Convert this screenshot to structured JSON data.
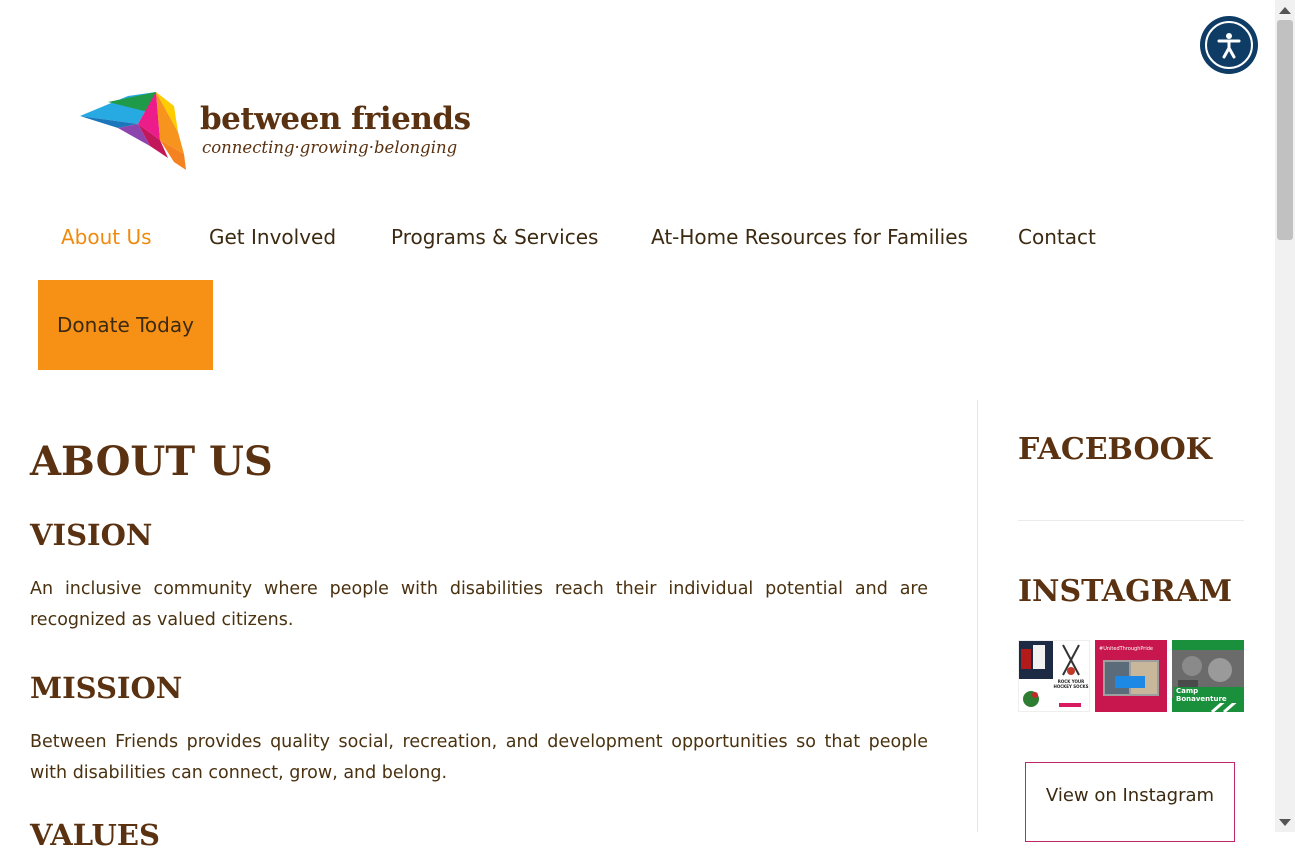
{
  "header": {
    "brand_name": "between friends",
    "tagline": "connecting·growing·belonging"
  },
  "nav": {
    "items": [
      {
        "label": "About Us",
        "active": true
      },
      {
        "label": "Get Involved"
      },
      {
        "label": "Programs & Services"
      },
      {
        "label": "At-Home Resources for Families"
      },
      {
        "label": "Contact"
      }
    ],
    "donate_label": "Donate Today"
  },
  "main": {
    "page_title": "ABOUT US",
    "vision_heading": "VISION",
    "vision_text": "An inclusive community where people with disabilities reach their individual potential and are recognized as valued citizens.",
    "mission_heading": "MISSION",
    "mission_text": "Between Friends provides quality social, recreation, and development opportunities so that people with disabilities can connect, grow, and belong.",
    "values_heading": "VALUES"
  },
  "sidebar": {
    "facebook_heading": "FACEBOOK",
    "instagram_heading": "INSTAGRAM",
    "instagram_thumbs": [
      {
        "caption": "ROCK YOUR HOCKEY SOCKS"
      },
      {
        "caption": "#UnitedThroughPride"
      },
      {
        "caption": "Camp Bonaventure"
      }
    ],
    "view_instagram_label": "View on Instagram"
  },
  "colors": {
    "brand_brown": "#5a3211",
    "nav_active": "#f08a0f",
    "donate_bg": "#f79116",
    "a11y_bg": "#0f3c64",
    "instagram_border": "#c0266a"
  },
  "icons": [
    "accessibility-icon",
    "kite-logo-icon"
  ]
}
